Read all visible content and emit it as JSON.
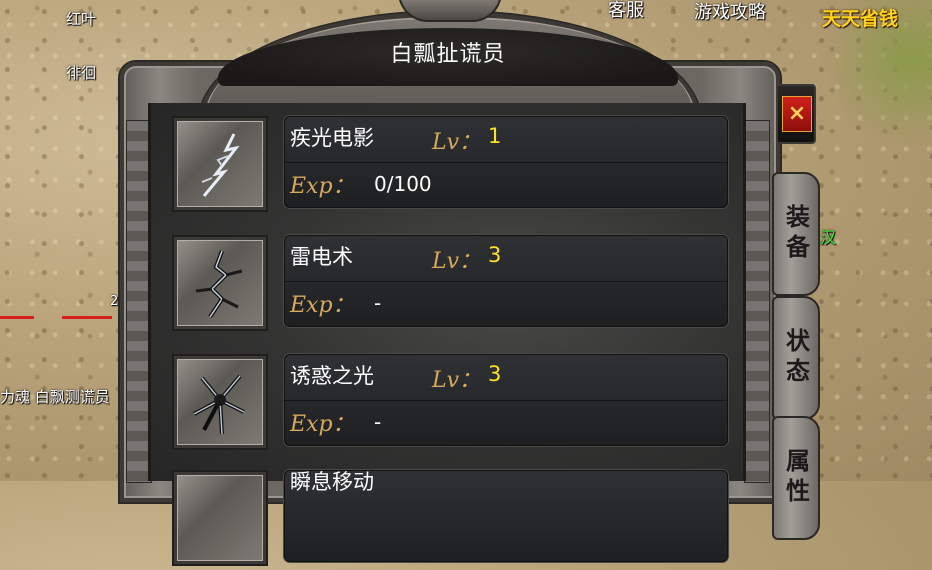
{
  "map": {
    "labels": [
      "红叶",
      "徘徊"
    ],
    "bottom_left_label": "力魂 白飘测谎员",
    "hp_number": "2",
    "top_menu": [
      "客服",
      "游戏攻略"
    ],
    "promo": "天天省钱",
    "green_name": "汉"
  },
  "panel": {
    "title": "白瓢扯谎员",
    "close_label": "×",
    "tabs": [
      "装备",
      "状态",
      "属性"
    ]
  },
  "skills": [
    {
      "name": "疾光电影",
      "lv_label": "Lv：",
      "lv": "1",
      "exp_label": "Exp：",
      "exp": "0/100",
      "icon": "lightning-bolt-icon"
    },
    {
      "name": "雷电术",
      "lv_label": "Lv：",
      "lv": "3",
      "exp_label": "Exp：",
      "exp": "-",
      "icon": "thunder-strike-icon"
    },
    {
      "name": "诱惑之光",
      "lv_label": "Lv：",
      "lv": "3",
      "exp_label": "Exp：",
      "exp": "-",
      "icon": "charm-light-icon"
    },
    {
      "name": "瞬息移动",
      "lv_label": "",
      "lv": "",
      "exp_label": "",
      "exp": "",
      "icon": "teleport-icon"
    }
  ],
  "colors": {
    "level_yellow": "#ffe12a",
    "label_gold": "#d6a95c",
    "close_red": "#d0201b"
  }
}
